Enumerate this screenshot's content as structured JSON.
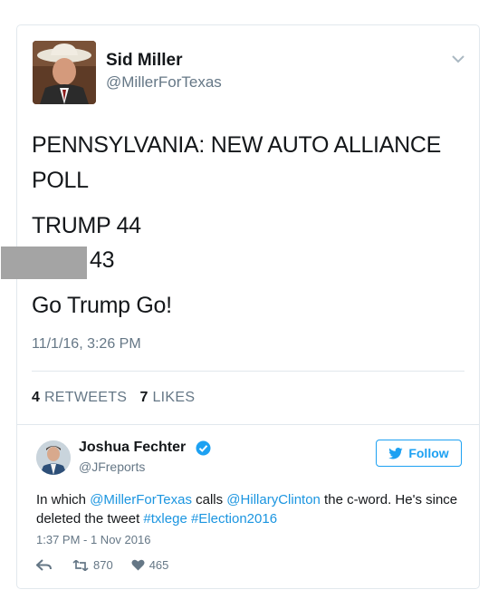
{
  "tweet": {
    "author_name": "Sid Miller",
    "author_handle": "@MillerForTexas",
    "lines": [
      "PENNSYLVANIA: NEW AUTO ALLIANCE",
      "POLL",
      "TRUMP 44",
      "43",
      "Go Trump Go!"
    ],
    "timestamp": "11/1/16, 3:26 PM",
    "retweets_count": "4",
    "retweets_label": "RETWEETS",
    "likes_count": "7",
    "likes_label": "LIKES"
  },
  "embed": {
    "author_name": "Joshua Fechter",
    "author_handle": "@JFreports",
    "follow_label": "Follow",
    "text_parts": [
      "In which ",
      "@MillerForTexas",
      " calls ",
      "@HillaryClinton",
      " the c-word. He's since deleted the tweet ",
      "#txlege",
      " ",
      "#Election2016"
    ],
    "timestamp": "1:37 PM - 1 Nov 2016",
    "retweet_count": "870",
    "like_count": "465"
  },
  "colors": {
    "accent": "#1da1f2",
    "link": "#1b95e0",
    "muted": "#657786",
    "redaction": "#a4a4a4"
  }
}
